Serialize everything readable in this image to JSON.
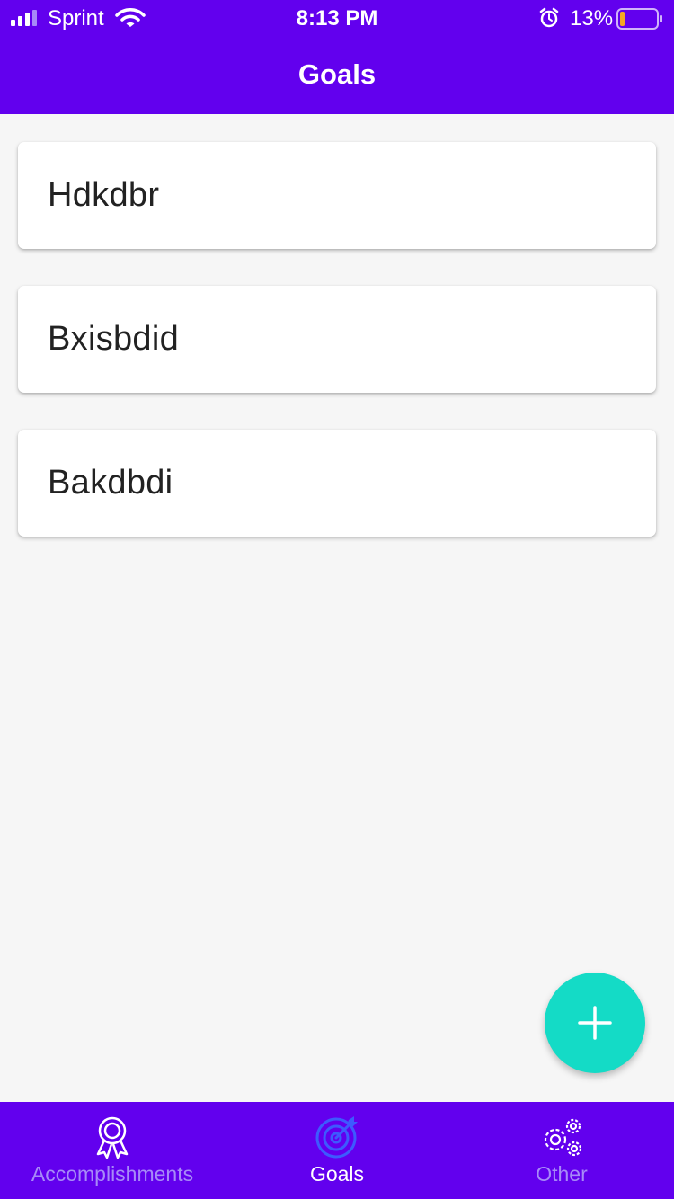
{
  "status_bar": {
    "carrier": "Sprint",
    "time": "8:13 PM",
    "battery_percent": "13%",
    "battery_level": 0.13,
    "icons": [
      "signal-icon",
      "wifi-icon",
      "alarm-icon",
      "battery-icon"
    ]
  },
  "header": {
    "title": "Goals"
  },
  "goals": [
    {
      "label": "Hdkdbr"
    },
    {
      "label": "Bxisbdid"
    },
    {
      "label": "Bakdbdi"
    }
  ],
  "fab": {
    "icon": "plus-icon"
  },
  "bottom_nav": {
    "items": [
      {
        "label": "Accomplishments",
        "icon": "award-ribbon-icon",
        "active": false
      },
      {
        "label": "Goals",
        "icon": "target-icon",
        "active": true
      },
      {
        "label": "Other",
        "icon": "gears-icon",
        "active": false
      }
    ]
  },
  "colors": {
    "primary": "#6200ee",
    "accent": "#14dbc6",
    "active_nav_icon": "#3d5afe",
    "inactive_nav": "#a78bf7",
    "background": "#f6f6f6",
    "battery_low": "#f5a623"
  }
}
